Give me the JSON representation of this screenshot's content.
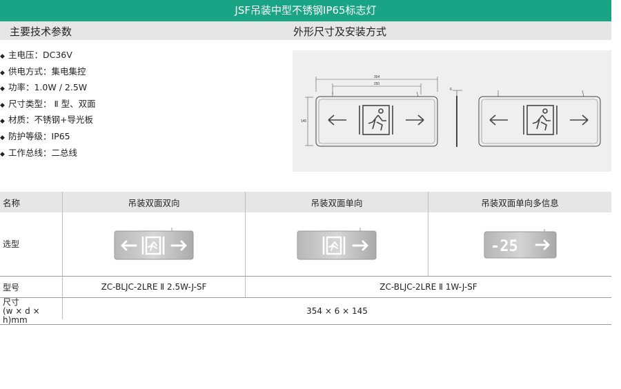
{
  "header": {
    "title": "JSF吊装中型不锈钢IP65标志灯"
  },
  "sections": {
    "left": "主要技术参数",
    "right": "外形尺寸及安装方式"
  },
  "specs": [
    "主电压：DC36V",
    "供电方式：集电集控",
    "功率：1.0W / 2.5W",
    "尺寸类型： Ⅱ 型、双面",
    "材质：不锈钢+导光板",
    "防护等级：IP65",
    "工作总线：二总线"
  ],
  "drawing": {
    "dim_total": "354",
    "dim_inner": "250",
    "dim_height": "145",
    "dim_depth": "6"
  },
  "table": {
    "headers": [
      "名称",
      "吊装双面双向",
      "吊装双面单向",
      "吊装双面单向多信息"
    ],
    "row_labels": {
      "type": "选型",
      "model": "型号",
      "size_line1": "尺寸",
      "size_line2": "(w × d × h)mm"
    },
    "models": [
      "ZC-BLJC-2LRE Ⅱ 2.5W-J-SF",
      "ZC-BLJC-2LRE Ⅱ 1W-J-SF"
    ],
    "size_value": "354 × 6 × 145",
    "info_sign_digits": "-25"
  },
  "colors": {
    "brand": "#1aa486",
    "bar": "#e6e6e6",
    "panel": "#efefef"
  }
}
